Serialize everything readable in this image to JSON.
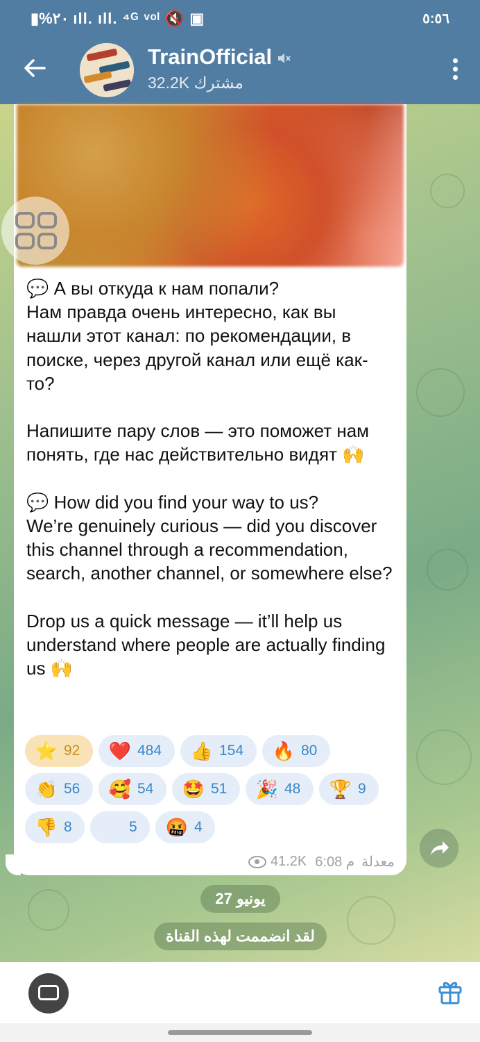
{
  "status_bar": {
    "left": "▮%٢٠ ıll. ıll. ⁴ᴳ ᵛᵒˡ 🔇 ▣",
    "time": "٥:٥٦"
  },
  "header": {
    "title": "TrainOfficial",
    "subscribers": "32.2K مشترك",
    "back_icon": "arrow-left-icon",
    "mute_icon": "muted-speaker-icon",
    "menu_icon": "more-vertical-icon"
  },
  "message": {
    "text": "💬 А вы откуда к нам попали?\nНам правда очень интересно, как вы нашли этот канал: по рекомендации, в поиске, через другой канал или ещё как-то?\n\nНапишите пару слов — это поможет нам понять, где нас действительно видят 🙌\n\n💬 How did you find your way to us?\nWe’re genuinely curious — did you discover this channel through a recommendation, search, another channel, or somewhere else?\n\nDrop us a quick message — it’ll help us understand where people are actually finding us 🙌",
    "views": "41.2K",
    "time": "6:08 م",
    "edited": "معدلة"
  },
  "reactions": [
    {
      "emoji": "⭐",
      "count": "92",
      "active": true
    },
    {
      "emoji": "❤️",
      "count": "484"
    },
    {
      "emoji": "👍",
      "count": "154"
    },
    {
      "emoji": "🔥",
      "count": "80"
    },
    {
      "emoji": "👏",
      "count": "56"
    },
    {
      "emoji": "🥰",
      "count": "54"
    },
    {
      "emoji": "🤩",
      "count": "51"
    },
    {
      "emoji": "🎉",
      "count": "48"
    },
    {
      "emoji": "🏆",
      "count": "9"
    },
    {
      "emoji": "👎",
      "count": "8"
    },
    {
      "emoji": "",
      "count": "5"
    },
    {
      "emoji": "🤬",
      "count": "4"
    }
  ],
  "date_divider": "27 يونيو",
  "service_message": "لقد انضممت لهذه القناة",
  "colors": {
    "header": "#527da3",
    "reaction_bg": "#e5eef8",
    "reaction_text": "#3a86c8",
    "star_reaction_bg": "#f9e3b6"
  }
}
